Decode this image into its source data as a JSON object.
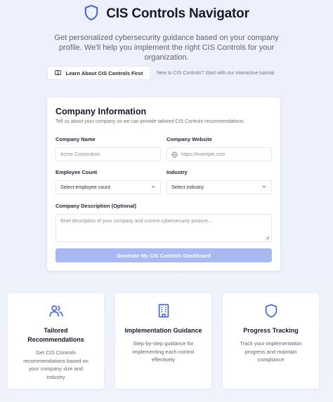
{
  "header": {
    "title": "CIS Controls Navigator",
    "subtitle": "Get personalized cybersecurity guidance based on your company profile. We'll help you implement the right CIS Controls for your organization.",
    "logo_icon": "shield-icon"
  },
  "learn": {
    "button_label": "Learn About CIS Controls First",
    "button_icon": "book-icon",
    "hint": "New to CIS Controls? Start with our interactive tutorial"
  },
  "form": {
    "title": "Company Information",
    "description": "Tell us about your company so we can provide tailored CIS Controls recommendations",
    "company_name": {
      "label": "Company Name",
      "placeholder": "Acme Corporation",
      "value": ""
    },
    "company_website": {
      "label": "Company Website",
      "placeholder": "https://example.com",
      "value": ""
    },
    "employee_count": {
      "label": "Employee Count",
      "selected": "Select employee count"
    },
    "industry": {
      "label": "Industry",
      "selected": "Select industry"
    },
    "company_description": {
      "label": "Company Description (Optional)",
      "placeholder": "Brief description of your company and current cybersecurity posture..."
    },
    "submit_label": "Generate My CIS Controls Dashboard"
  },
  "features": [
    {
      "icon": "users-icon",
      "title": "Tailored Recommendations",
      "description": "Get CIS Controls recommendations based on your company size and industry"
    },
    {
      "icon": "building-icon",
      "title": "Implementation Guidance",
      "description": "Step-by-step guidance for implementing each control effectively"
    },
    {
      "icon": "shield-icon",
      "title": "Progress Tracking",
      "description": "Track your implementation progress and maintain compliance"
    }
  ],
  "colors": {
    "accent": "#3f63d8",
    "button_disabled": "#a8b8f0"
  }
}
